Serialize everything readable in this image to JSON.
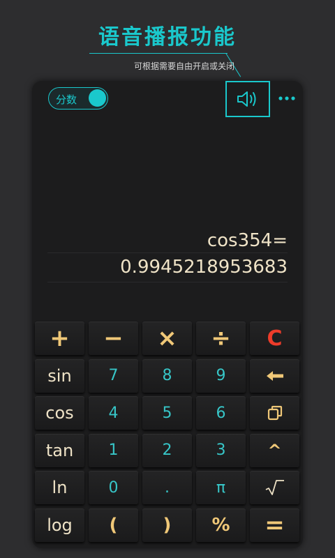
{
  "promo": {
    "title": "语音播报功能",
    "subtitle": "可根据需要自由开启或关闭"
  },
  "toolbar": {
    "fraction_toggle_label": "分数",
    "fraction_toggle_on": true,
    "speaker_icon": "speaker-icon",
    "more_icon": "more-icon"
  },
  "display": {
    "expression": "cos354=",
    "result": "0.9945218953683"
  },
  "keypad": {
    "rows": [
      [
        "+",
        "−",
        "×",
        "÷",
        "C"
      ],
      [
        "sin",
        "7",
        "8",
        "9",
        "←"
      ],
      [
        "cos",
        "4",
        "5",
        "6",
        "copy-icon"
      ],
      [
        "tan",
        "1",
        "2",
        "3",
        "^"
      ],
      [
        "ln",
        "0",
        ".",
        "π",
        "sqrt-icon"
      ],
      [
        "log",
        "(",
        ")",
        "%",
        "="
      ]
    ],
    "labels": {
      "plus": "+",
      "minus": "−",
      "multiply": "×",
      "divide": "÷",
      "clear": "C",
      "sin": "sin",
      "seven": "7",
      "eight": "8",
      "nine": "9",
      "backspace": "←",
      "cos": "cos",
      "four": "4",
      "five": "5",
      "six": "6",
      "tan": "tan",
      "one": "1",
      "two": "2",
      "three": "3",
      "power": "^",
      "ln": "ln",
      "zero": "0",
      "dot": ".",
      "pi": "π",
      "log": "log",
      "open_paren": "(",
      "close_paren": ")",
      "percent": "%",
      "equals": "="
    }
  },
  "colors": {
    "accent": "#1ac8cc",
    "function_text": "#efe3c7",
    "digit_text": "#37c6c8",
    "operator_text": "#f0c878",
    "clear_text": "#ee3c2a",
    "panel_bg": "#1c1c1d",
    "page_bg": "#2d2d2f"
  }
}
